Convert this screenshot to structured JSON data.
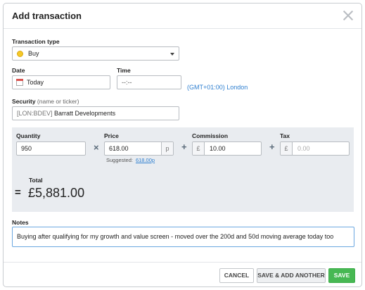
{
  "dialog": {
    "title": "Add transaction"
  },
  "transaction_type": {
    "label": "Transaction type",
    "value": "Buy"
  },
  "date": {
    "label": "Date",
    "value": "Today"
  },
  "time": {
    "label": "Time",
    "value": "--:--"
  },
  "timezone": {
    "text": "(GMT+01:00) London"
  },
  "security": {
    "label": "Security",
    "label_hint": "(name or ticker)",
    "prefix": "[LON:BDEV]",
    "name": "Barratt Developments"
  },
  "quantity": {
    "label": "Quantity",
    "value": "950"
  },
  "price": {
    "label": "Price",
    "value": "618.00",
    "unit": "p",
    "suggested_label": "Suggested:",
    "suggested_value": "618.00p"
  },
  "commission": {
    "label": "Commission",
    "currency": "£",
    "value": "10.00"
  },
  "tax": {
    "label": "Tax",
    "currency": "£",
    "placeholder": "0.00"
  },
  "operators": {
    "multiply": "×",
    "plus": "+",
    "equals": "="
  },
  "total": {
    "label": "Total",
    "value": "£5,881.00"
  },
  "notes": {
    "label": "Notes",
    "value": "Buying after qualifying for my growth and value screen - moved over the 200d and 50d moving average today too"
  },
  "buttons": {
    "cancel": "CANCEL",
    "save_and_add": "SAVE & ADD ANOTHER",
    "save": "SAVE"
  },
  "colors": {
    "accent_link": "#2e7fd0",
    "save_green": "#47b853",
    "panel_bg": "#e9ecf0",
    "focus_border": "#6aa7e0"
  }
}
